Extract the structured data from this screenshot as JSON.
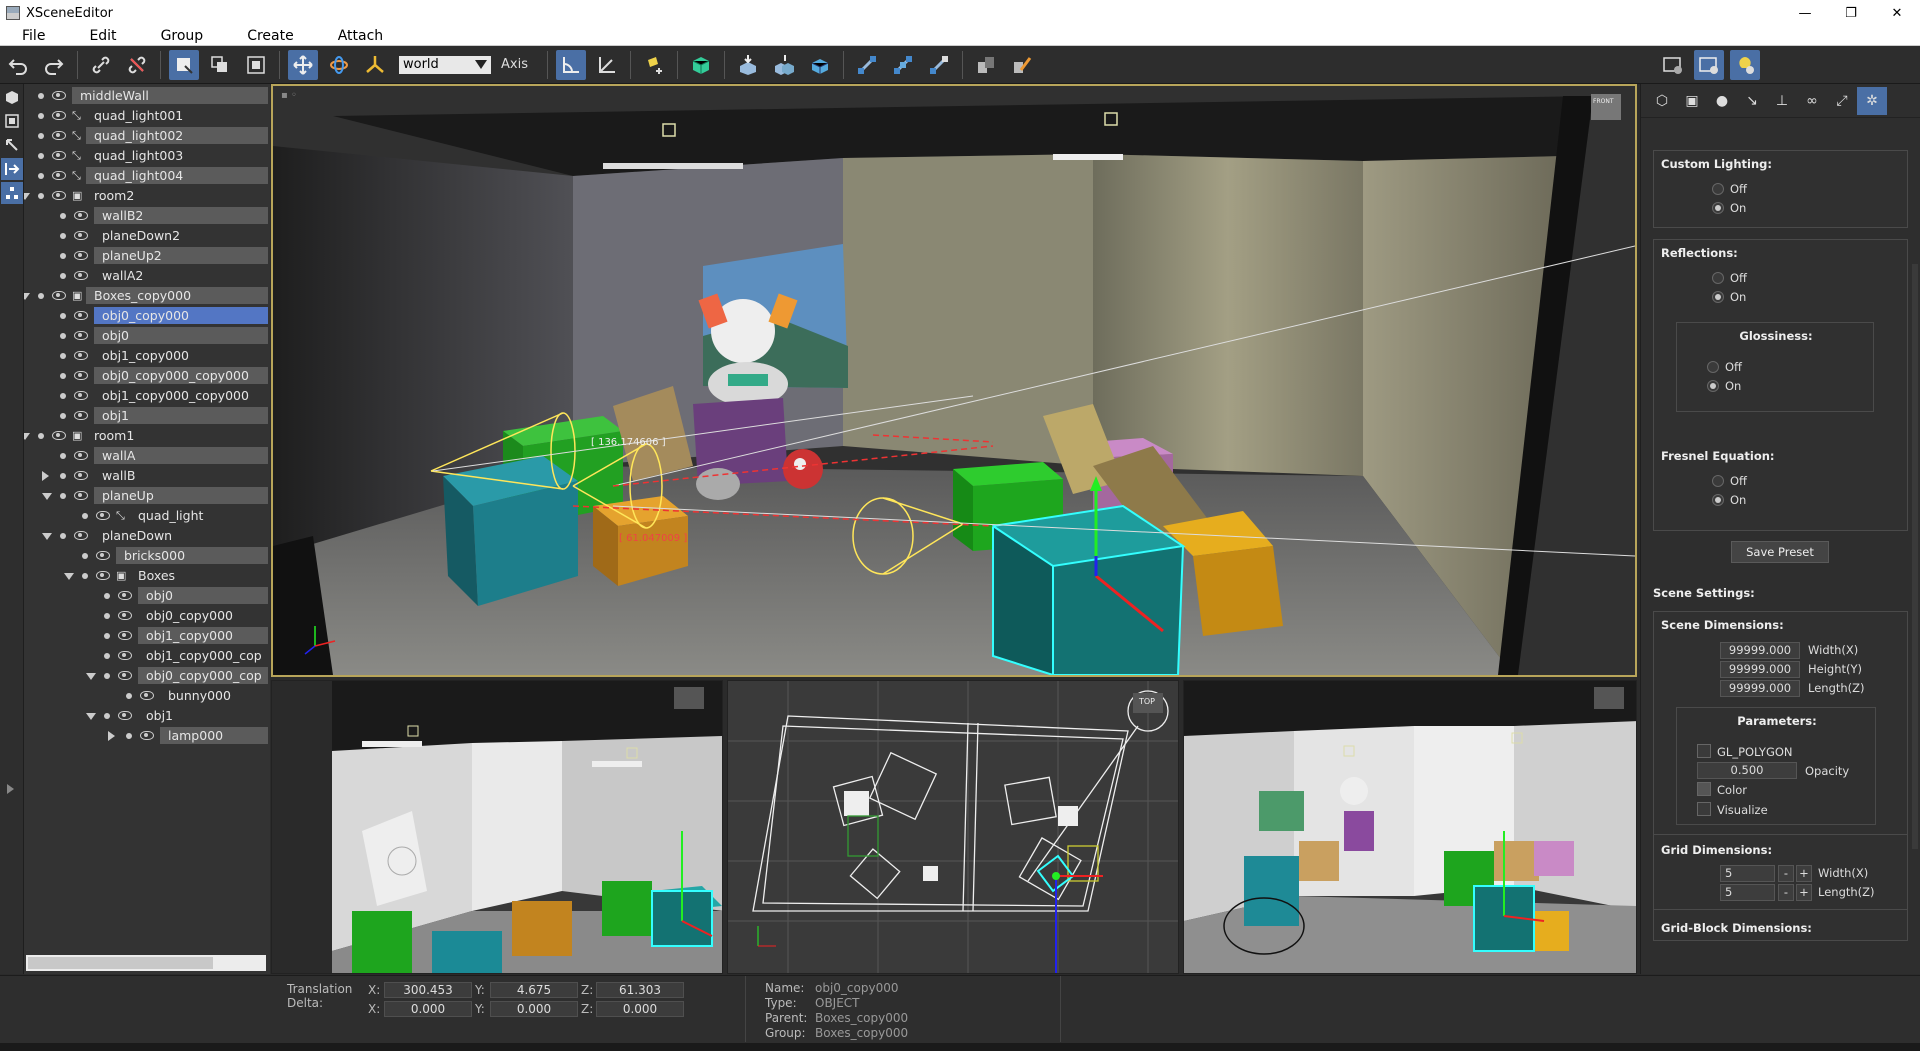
{
  "window": {
    "title": "XSceneEditor",
    "min": "—",
    "max": "❐",
    "close": "✕"
  },
  "menu": [
    "File",
    "Edit",
    "Group",
    "Create",
    "Attach"
  ],
  "toolbar": {
    "coord_space": "world",
    "axis_label": "Axis"
  },
  "tree": [
    {
      "label": "middleWall",
      "type": "plane",
      "depth": 0,
      "hl": true
    },
    {
      "label": "quad_light001",
      "type": "light",
      "depth": 0
    },
    {
      "label": "quad_light002",
      "type": "light",
      "depth": 0,
      "hl": true
    },
    {
      "label": "quad_light003",
      "type": "light",
      "depth": 0
    },
    {
      "label": "quad_light004",
      "type": "light",
      "depth": 0,
      "hl": true
    },
    {
      "label": "room2",
      "type": "group",
      "depth": 0,
      "expand": "down"
    },
    {
      "label": "wallB2",
      "type": "obj",
      "depth": 1,
      "hl": true
    },
    {
      "label": "planeDown2",
      "type": "obj",
      "depth": 1
    },
    {
      "label": "planeUp2",
      "type": "obj",
      "depth": 1,
      "hl": true
    },
    {
      "label": "wallA2",
      "type": "obj",
      "depth": 1
    },
    {
      "label": "Boxes_copy000",
      "type": "group",
      "depth": 0,
      "expand": "down",
      "hl": true
    },
    {
      "label": "obj0_copy000",
      "type": "obj",
      "depth": 1,
      "sel": true
    },
    {
      "label": "obj0",
      "type": "obj",
      "depth": 1,
      "hl": true
    },
    {
      "label": "obj1_copy000",
      "type": "obj",
      "depth": 1
    },
    {
      "label": "obj0_copy000_copy000",
      "type": "obj",
      "depth": 1,
      "hl": true
    },
    {
      "label": "obj1_copy000_copy000",
      "type": "obj",
      "depth": 1
    },
    {
      "label": "obj1",
      "type": "obj",
      "depth": 1,
      "hl": true
    },
    {
      "label": "room1",
      "type": "group",
      "depth": 0,
      "expand": "down"
    },
    {
      "label": "wallA",
      "type": "obj",
      "depth": 1,
      "hl": true
    },
    {
      "label": "wallB",
      "type": "obj",
      "depth": 1,
      "expand": "right"
    },
    {
      "label": "planeUp",
      "type": "obj",
      "depth": 1,
      "expand": "down",
      "hl": true
    },
    {
      "label": "quad_light",
      "type": "light",
      "depth": 2
    },
    {
      "label": "planeDown",
      "type": "obj",
      "depth": 1,
      "expand": "down"
    },
    {
      "label": "bricks000",
      "type": "obj",
      "depth": 2,
      "hl": true
    },
    {
      "label": "Boxes",
      "type": "group",
      "depth": 2,
      "expand": "down"
    },
    {
      "label": "obj0",
      "type": "obj",
      "depth": 3,
      "hl": true
    },
    {
      "label": "obj0_copy000",
      "type": "obj",
      "depth": 3
    },
    {
      "label": "obj1_copy000",
      "type": "obj",
      "depth": 3,
      "hl": true
    },
    {
      "label": "obj1_copy000_cop",
      "type": "obj",
      "depth": 3
    },
    {
      "label": "obj0_copy000_cop",
      "type": "obj",
      "depth": 3,
      "expand": "down",
      "hl": true
    },
    {
      "label": "bunny000",
      "type": "obj",
      "depth": 4
    },
    {
      "label": "obj1",
      "type": "obj",
      "depth": 3,
      "expand": "down"
    },
    {
      "label": "lamp000",
      "type": "obj",
      "depth": 4,
      "expand": "right",
      "hl": true
    }
  ],
  "viewport": {
    "main_label_top": "[ 136.174606 ]",
    "main_label_bottom": "[ 61.047009 ]",
    "cube_front": "FRONT",
    "cube_top": "TOP"
  },
  "panel": {
    "custom_lighting": {
      "title": "Custom Lighting:",
      "off": "Off",
      "on": "On"
    },
    "reflections": {
      "title": "Reflections:",
      "off": "Off",
      "on": "On"
    },
    "glossiness": {
      "title": "Glossiness:",
      "off": "Off",
      "on": "On"
    },
    "fresnel": {
      "title": "Fresnel Equation:",
      "off": "Off",
      "on": "On"
    },
    "save_preset": "Save Preset",
    "scene_settings": "Scene Settings:",
    "scene_dimensions": {
      "title": "Scene Dimensions:",
      "width": "99999.000",
      "height": "99999.000",
      "length": "99999.000",
      "width_lbl": "Width(X)",
      "height_lbl": "Height(Y)",
      "length_lbl": "Length(Z)"
    },
    "parameters": {
      "title": "Parameters:",
      "gl_polygon": "GL_POLYGON",
      "opacity": "0.500",
      "opacity_lbl": "Opacity",
      "color": "Color",
      "visualize": "Visualize"
    },
    "grid_dimensions": {
      "title": "Grid Dimensions:",
      "width": "5",
      "length": "5",
      "width_lbl": "Width(X)",
      "length_lbl": "Length(Z)",
      "minus": "-",
      "plus": "+"
    },
    "grid_block": "Grid-Block Dimensions:"
  },
  "bottom": {
    "translation_lbl": "Translation",
    "delta_lbl": "Delta:",
    "x_lbl": "X:",
    "y_lbl": "Y:",
    "z_lbl": "Z:",
    "tx": "300.453",
    "ty": "4.675",
    "tz": "61.303",
    "dx": "0.000",
    "dy": "0.000",
    "dz": "0.000",
    "name_lbl": "Name:",
    "type_lbl": "Type:",
    "parent_lbl": "Parent:",
    "group_lbl": "Group:",
    "name": "obj0_copy000",
    "type": "OBJECT",
    "parent": "Boxes_copy000",
    "group": "Boxes_copy000"
  }
}
